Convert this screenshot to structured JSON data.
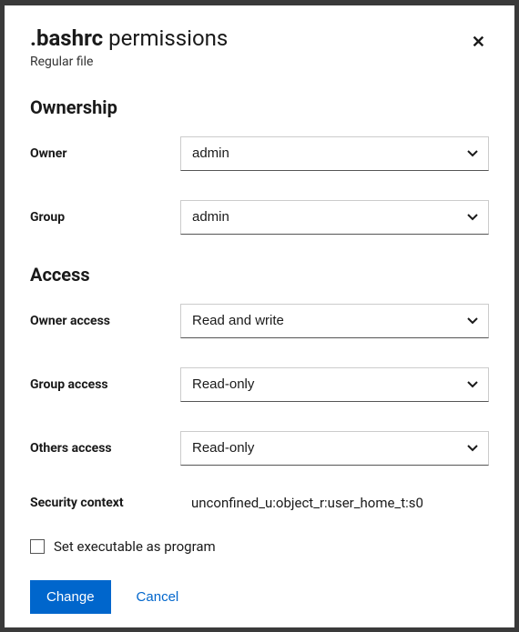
{
  "title": {
    "filename": ".bashrc",
    "suffix": " permissions"
  },
  "subtitle": "Regular file",
  "sections": {
    "ownership": {
      "heading": "Ownership",
      "owner": {
        "label": "Owner",
        "value": "admin"
      },
      "group": {
        "label": "Group",
        "value": "admin"
      }
    },
    "access": {
      "heading": "Access",
      "owner_access": {
        "label": "Owner access",
        "value": "Read and write"
      },
      "group_access": {
        "label": "Group access",
        "value": "Read-only"
      },
      "others_access": {
        "label": "Others access",
        "value": "Read-only"
      },
      "security_context": {
        "label": "Security context",
        "value": "unconfined_u:object_r:user_home_t:s0"
      }
    }
  },
  "executable": {
    "label": "Set executable as program",
    "checked": false
  },
  "buttons": {
    "change": "Change",
    "cancel": "Cancel"
  }
}
